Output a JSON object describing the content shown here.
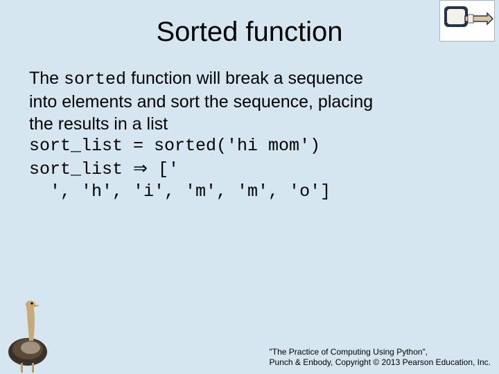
{
  "title": "Sorted function",
  "body": {
    "line1_pre": "The ",
    "line1_code": "sorted",
    "line1_post": " function will break a sequence",
    "line2": "into elements and sort the sequence, placing",
    "line3": "the results in a list",
    "code1": "sort_list = sorted('hi mom')",
    "code2_lhs": "sort_list ",
    "code2_arrow": "⇒",
    "code2_rhs": " ['",
    "code3": "  ', 'h', 'i', 'm', 'm', 'o']"
  },
  "footer": {
    "line1": "\"The Practice of Computing Using Python\",",
    "line2": "Punch & Enbody, Copyright © 2013 Pearson Education, Inc."
  },
  "icons": {
    "hand": "pointing-hand-icon",
    "ostrich": "ostrich-icon"
  }
}
